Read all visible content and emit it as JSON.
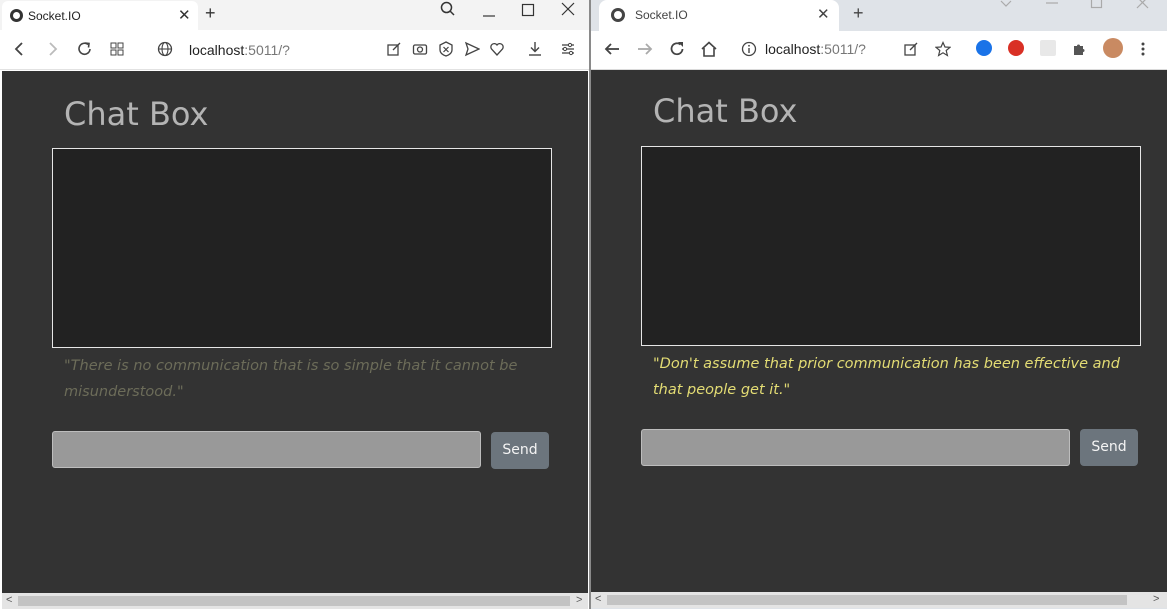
{
  "left_window": {
    "tab_title": "Socket.IO",
    "new_tab_label": "+",
    "url_host": "localhost",
    "url_rest": ":5011/?",
    "page": {
      "title": "Chat Box",
      "quote": "\"There is no communication that is so simple that it cannot be misunderstood.\"",
      "input_value": "",
      "send_label": "Send",
      "quote_color": "#6c6c59"
    }
  },
  "right_window": {
    "tab_title": "Socket.IO",
    "new_tab_label": "+",
    "url_host": "localhost",
    "url_rest": ":5011/?",
    "page": {
      "title": "Chat Box",
      "quote": "\"Don't assume that prior communication has been effective and that people get it.\"",
      "input_value": "",
      "send_label": "Send",
      "quote_color": "#e3dc74"
    }
  },
  "colors": {
    "page_bg": "#333333",
    "chat_box_bg": "#222222",
    "input_bg": "#999999",
    "button_bg": "#6c757d",
    "title_color": "#b4b4b4"
  }
}
